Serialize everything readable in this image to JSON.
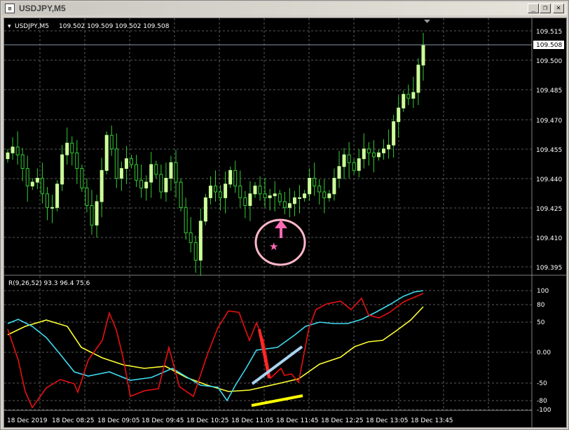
{
  "window": {
    "title": "USDJPY,M5",
    "icon_name": "chart-window-icon",
    "minimize_label": "_",
    "restore_label": "❐",
    "close_label": "✕"
  },
  "header": {
    "symbol": "USDJPY,M5",
    "ohlc": "109.502 109.509 109.502 109.508"
  },
  "price_axis": {
    "labels": [
      "109.515",
      "109.500",
      "109.485",
      "109.470",
      "109.455",
      "109.440",
      "109.425",
      "109.410",
      "109.395"
    ],
    "current_price": "109.508"
  },
  "indicator": {
    "label": "R(9,26,52) 93.3 96.4 75.6",
    "axis_labels": [
      "100",
      "80",
      "50",
      "0.00",
      "-50",
      "-80",
      "-100"
    ]
  },
  "time_axis": {
    "labels": [
      "18 Dec 2019",
      "18 Dec 08:25",
      "18 Dec 09:05",
      "18 Dec 09:45",
      "18 Dec 10:25",
      "18 Dec 11:05",
      "18 Dec 11:45",
      "18 Dec 12:25",
      "18 Dec 13:05",
      "18 Dec 13:45"
    ]
  },
  "colors": {
    "background": "#000000",
    "grid": "#5a5a5a",
    "axis_text": "#ffffff",
    "bull_candle": "#ccff99",
    "wick": "#33cc33",
    "line_red": "#e81010",
    "line_cyan": "#40d8f0",
    "line_yellow": "#ffff33",
    "annot_red": "#ff2a2a",
    "annot_lightblue": "#a8d4f0",
    "annot_yellow": "#ffff00",
    "marker_pink": "#ff69b4",
    "circle_pink": "#ffb6c8"
  },
  "chart_data": {
    "type": "candlestick",
    "symbol": "USDJPY",
    "timeframe": "M5",
    "ylim": [
      109.39,
      109.52
    ],
    "last_price": 109.508,
    "close": [
      109.453,
      109.456,
      109.452,
      109.445,
      109.436,
      109.438,
      109.44,
      109.432,
      109.425,
      109.425,
      109.437,
      109.452,
      109.458,
      109.453,
      109.445,
      109.435,
      109.426,
      109.416,
      109.428,
      109.444,
      109.462,
      109.455,
      109.44,
      109.445,
      109.45,
      109.447,
      109.439,
      109.435,
      109.438,
      109.447,
      109.442,
      109.433,
      109.44,
      109.448,
      109.438,
      109.425,
      109.412,
      109.407,
      109.398,
      109.418,
      109.43,
      109.436,
      109.433,
      109.43,
      109.437,
      109.444,
      109.436,
      109.43,
      109.426,
      109.432,
      109.436,
      109.432,
      109.43,
      109.431,
      109.432,
      109.428,
      109.425,
      109.427,
      109.43,
      109.43,
      109.432,
      109.44,
      109.436,
      109.433,
      109.43,
      109.432,
      109.44,
      109.446,
      109.452,
      109.448,
      109.444,
      109.45,
      109.455,
      109.453,
      109.451,
      109.453,
      109.455,
      109.457,
      109.469,
      109.476,
      109.483,
      109.481,
      109.484,
      109.498,
      109.508
    ]
  }
}
